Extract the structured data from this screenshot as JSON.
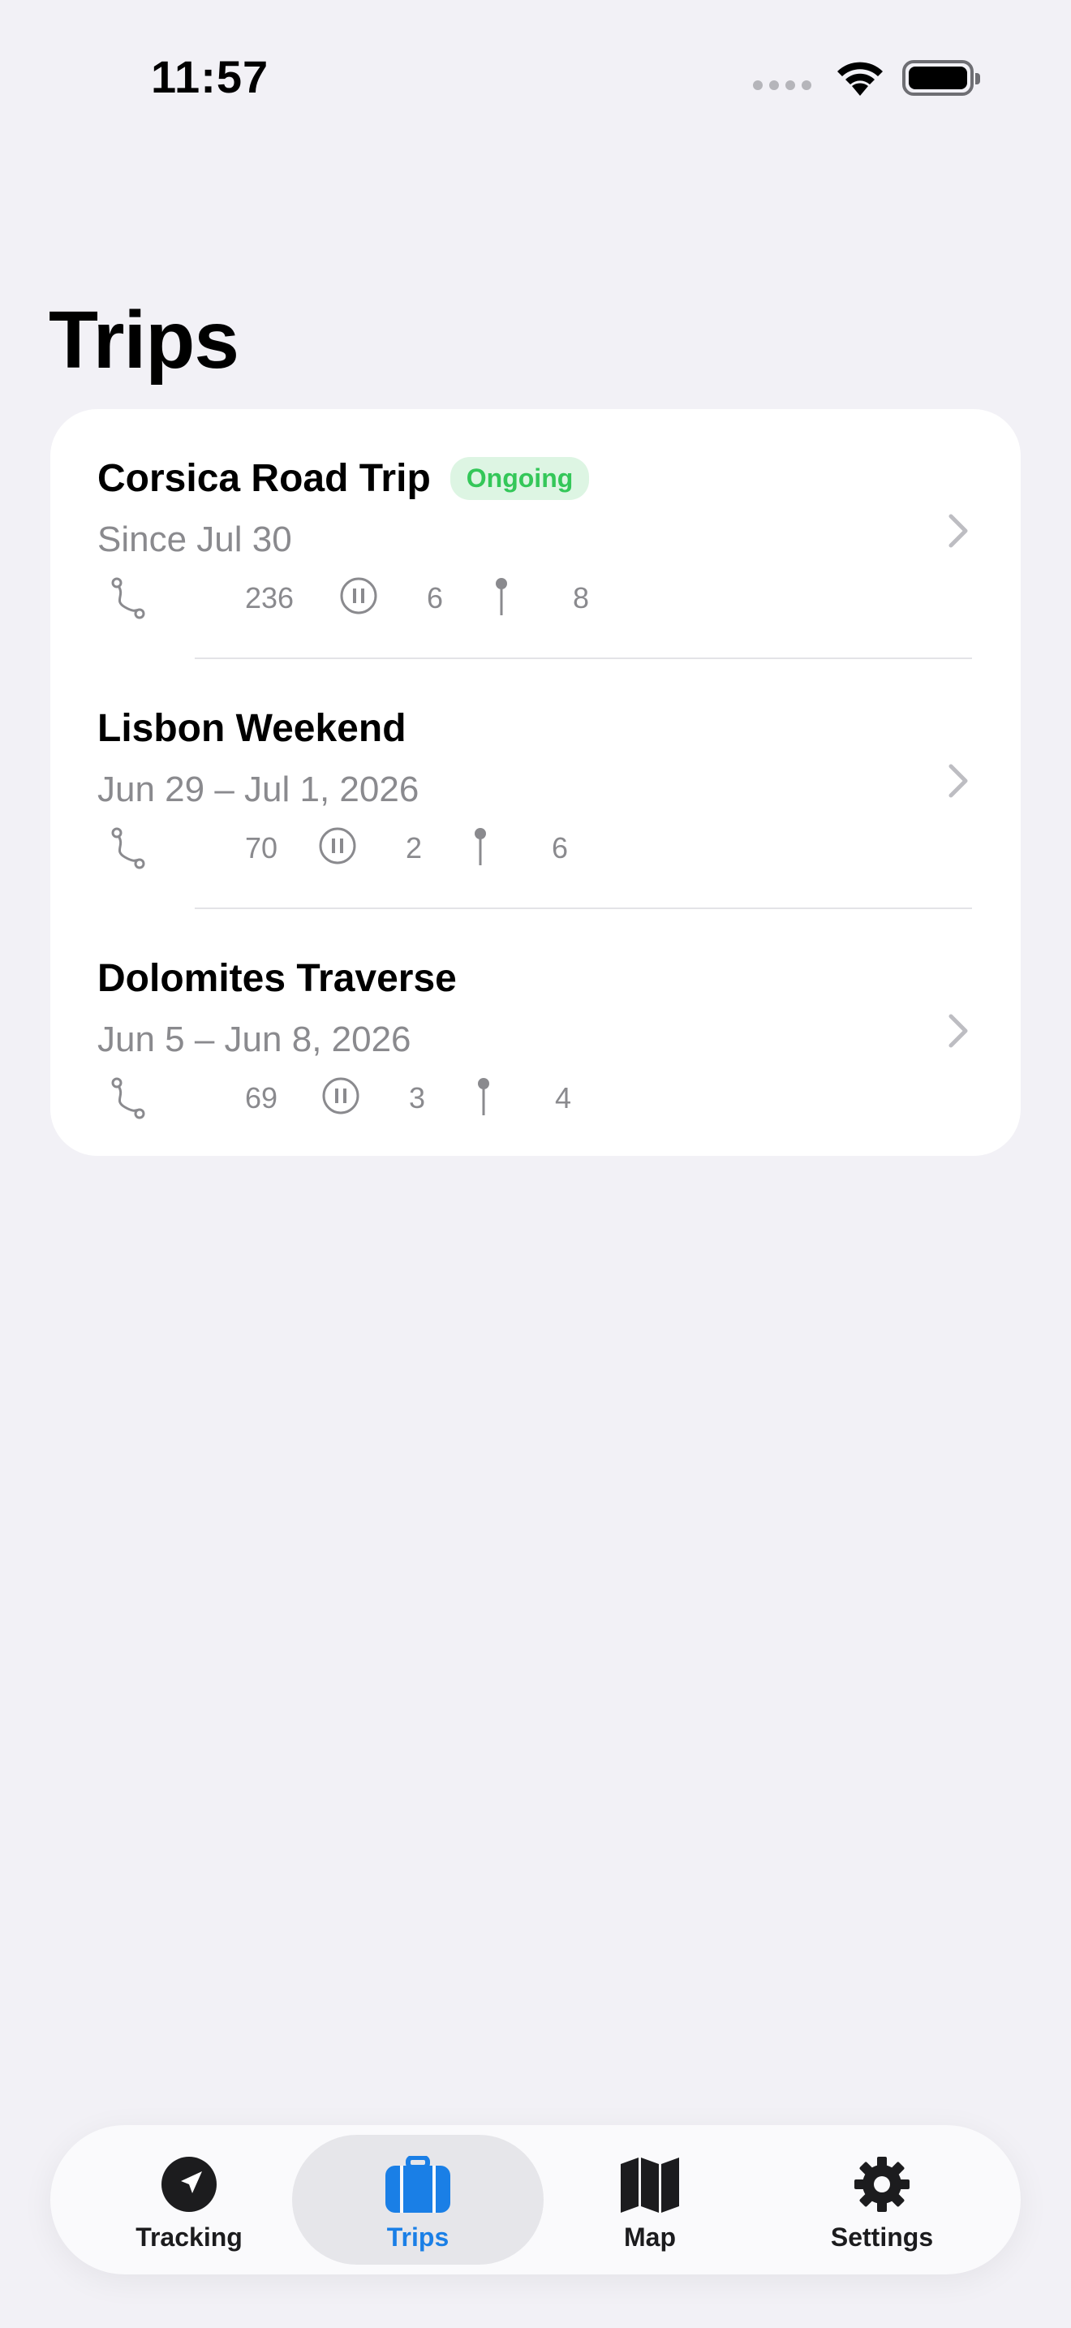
{
  "status_bar": {
    "time": "11:57"
  },
  "page": {
    "title": "Trips"
  },
  "trips": [
    {
      "name": "Corsica Road Trip",
      "badge": "Ongoing",
      "dates": "Since Jul 30",
      "route_points": "236",
      "pauses": "6",
      "pins": "8"
    },
    {
      "name": "Lisbon Weekend",
      "badge": "",
      "dates": "Jun 29 – Jul 1, 2026",
      "route_points": "70",
      "pauses": "2",
      "pins": "6"
    },
    {
      "name": "Dolomites Traverse",
      "badge": "",
      "dates": "Jun 5 – Jun 8, 2026",
      "route_points": "69",
      "pauses": "3",
      "pins": "4"
    }
  ],
  "tab_bar": {
    "tabs": [
      {
        "label": "Tracking",
        "icon": "location-arrow-icon",
        "active": false
      },
      {
        "label": "Trips",
        "icon": "suitcase-icon",
        "active": true
      },
      {
        "label": "Map",
        "icon": "map-icon",
        "active": false
      },
      {
        "label": "Settings",
        "icon": "gear-icon",
        "active": false
      }
    ]
  },
  "colors": {
    "accent": "#1A7FE6",
    "ongoing_badge_text": "#34C759",
    "ongoing_badge_bg": "#DDF5E3",
    "secondary_text": "#8A8A8E",
    "background": "#F2F1F6"
  }
}
